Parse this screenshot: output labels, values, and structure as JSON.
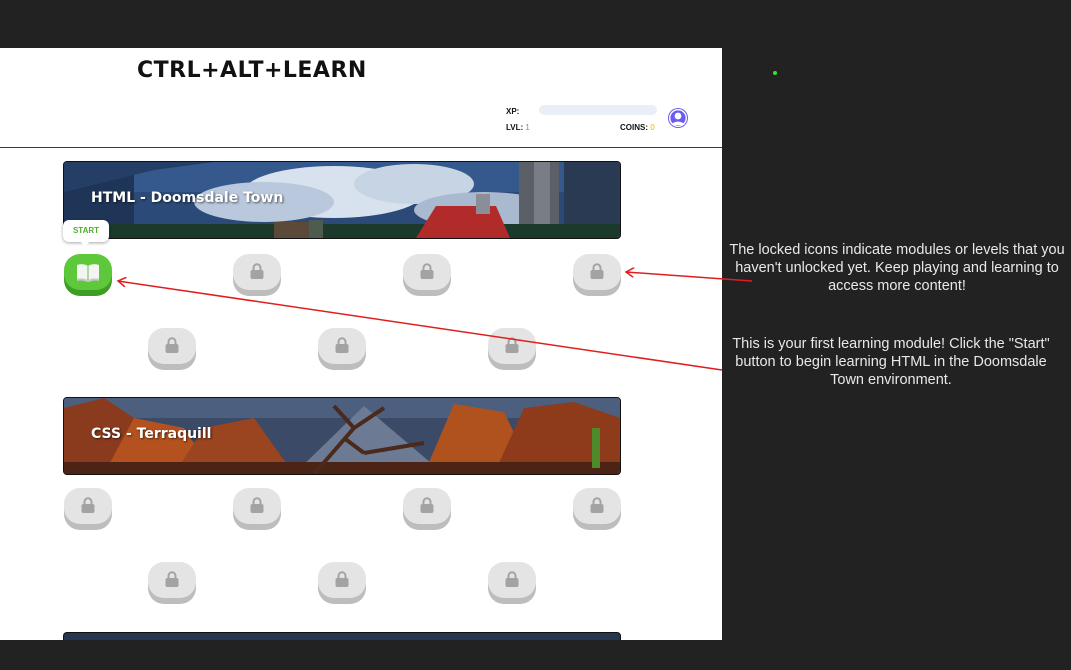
{
  "app": {
    "title": "CTRL+ALT+LEARN"
  },
  "stats": {
    "xp_label": "XP:",
    "lvl_label": "LVL:",
    "lvl_value": "1",
    "coins_label": "COINS:",
    "coins_value": "0",
    "xp_progress": 0
  },
  "modules": [
    {
      "title": "HTML - Doomsdale Town",
      "start_label": "START"
    },
    {
      "title": "CSS - Terraquill"
    }
  ],
  "annotations": {
    "locked_note": "The locked icons indicate modules or levels that you haven't unlocked yet. Keep playing and learning to access more content!",
    "start_note": "This is your first learning module! Click the \"Start\" button to begin learning HTML in the Doomsdale Town environment."
  },
  "colors": {
    "accent_green": "#5cc83a",
    "lvl_value": "#3aa6d8",
    "coins_value": "#e6b800",
    "arrow": "#e01e1e",
    "avatar": "#6a5cf0"
  },
  "icons": [
    "book-icon",
    "lock-icon",
    "user-icon"
  ]
}
